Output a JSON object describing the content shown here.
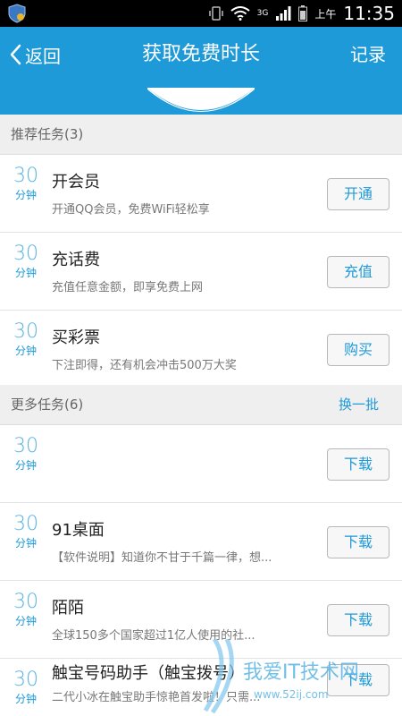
{
  "status_bar": {
    "ampm": "上午",
    "time": "11:35",
    "network": "3G"
  },
  "header": {
    "back_label": "返回",
    "title": "获取免费时长",
    "record_label": "记录"
  },
  "recommended": {
    "label": "推荐任务(3)",
    "tasks": [
      {
        "minutes": "30",
        "unit": "分钟",
        "name": "开会员",
        "desc": "开通QQ会员，免费WiFi轻松享",
        "button": "开通"
      },
      {
        "minutes": "30",
        "unit": "分钟",
        "name": "充话费",
        "desc": "充值任意金额，即享免费上网",
        "button": "充值"
      },
      {
        "minutes": "30",
        "unit": "分钟",
        "name": "买彩票",
        "desc": "下注即得，还有机会冲击500万大奖",
        "button": "购买"
      }
    ]
  },
  "more": {
    "label": "更多任务(6)",
    "refresh_label": "换一批",
    "tasks": [
      {
        "minutes": "30",
        "unit": "分钟",
        "name": "",
        "desc": "",
        "button": "下载"
      },
      {
        "minutes": "30",
        "unit": "分钟",
        "name": "91桌面",
        "desc": "【软件说明】知道你不甘于千篇一律，想...",
        "button": "下载"
      },
      {
        "minutes": "30",
        "unit": "分钟",
        "name": "陌陌",
        "desc": "全球150多个国家超过1亿人使用的社...",
        "button": "下载"
      },
      {
        "minutes": "30",
        "unit": "分钟",
        "name": "触宝号码助手（触宝拨号）",
        "desc": "二代小冰在触宝助手惊艳首发啦！只需...",
        "button": "下载"
      }
    ]
  },
  "watermark": {
    "text": "我爱IT技术网",
    "url": "www.52ij.com"
  },
  "colors": {
    "accent": "#1f9ad9",
    "section_bg": "#efefef",
    "status_bar": "#000000"
  }
}
